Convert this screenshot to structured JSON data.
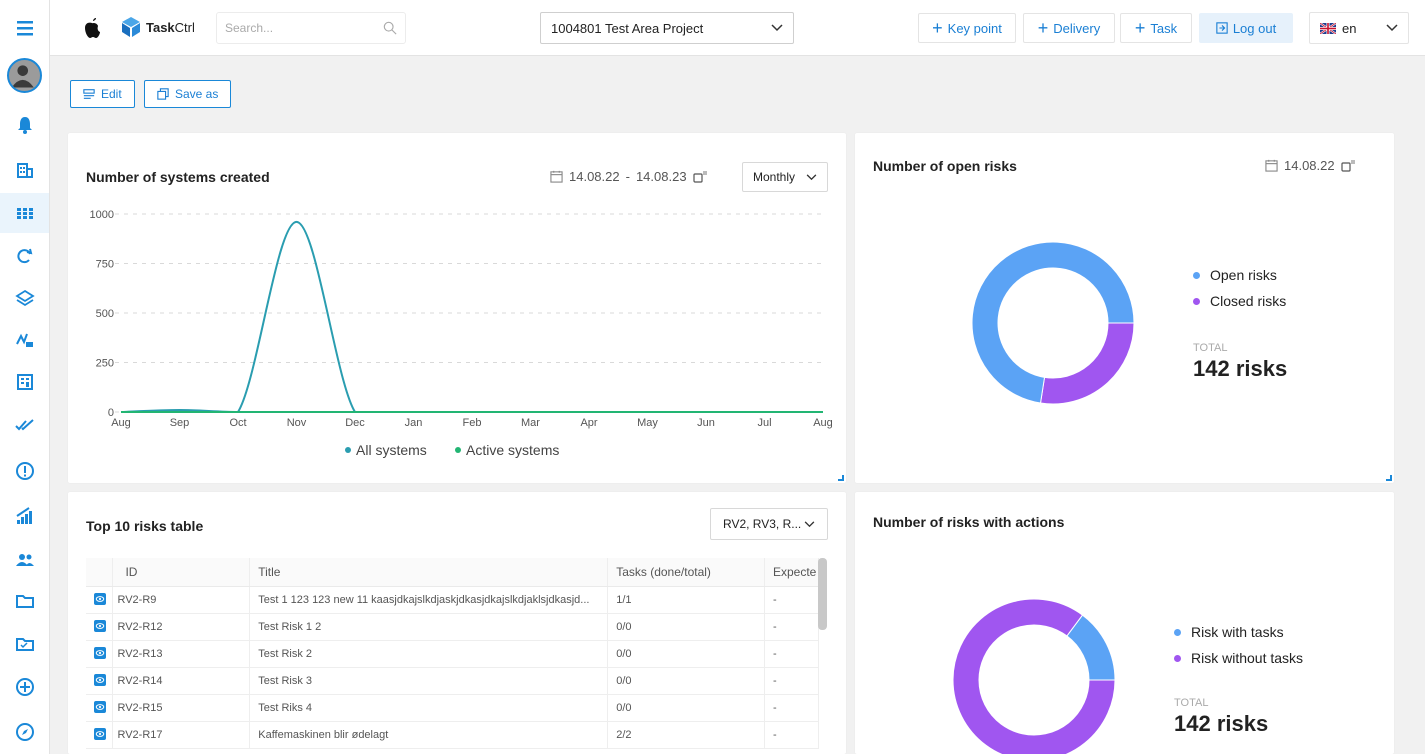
{
  "header": {
    "app_name_bold": "Task",
    "app_name_regular": "Ctrl",
    "search_placeholder": "Search...",
    "project": "1004801 Test Area Project",
    "buttons": {
      "key_point": "Key point",
      "delivery": "Delivery",
      "task": "Task",
      "logout": "Log out"
    },
    "language": "en"
  },
  "actions": {
    "edit": "Edit",
    "save_as": "Save as"
  },
  "systems_card": {
    "title": "Number of systems created",
    "date_from": "14.08.22",
    "date_sep": "-",
    "date_to": "14.08.23",
    "period": "Monthly",
    "chart_data": {
      "type": "line",
      "x": [
        "Aug",
        "Sep",
        "Oct",
        "Nov",
        "Dec",
        "Jan",
        "Feb",
        "Mar",
        "Apr",
        "May",
        "Jun",
        "Jul",
        "Aug"
      ],
      "series": [
        {
          "name": "All systems",
          "values": [
            0,
            10,
            0,
            960,
            0,
            0,
            0,
            0,
            0,
            0,
            0,
            0,
            0
          ],
          "color": "#2a9db0"
        },
        {
          "name": "Active systems",
          "values": [
            0,
            0,
            0,
            0,
            0,
            0,
            0,
            0,
            0,
            0,
            0,
            0,
            0
          ],
          "color": "#22b573"
        }
      ],
      "yticks": [
        "1000",
        "750",
        "500",
        "250",
        "0"
      ],
      "ylim": [
        0,
        1000
      ],
      "grid": true,
      "legend": "bottom"
    }
  },
  "open_risks_card": {
    "title": "Number of open risks",
    "date": "14.08.22",
    "chart_data": {
      "type": "pie",
      "categories": [
        "Open risks",
        "Closed risks"
      ],
      "values": [
        103,
        39
      ],
      "colors": [
        "#5ba3f5",
        "#a056f0"
      ]
    },
    "total_label": "TOTAL",
    "total_value": "142 risks"
  },
  "risks_table_card": {
    "title": "Top 10 risks table",
    "filter": "RV2, RV3, R...",
    "columns": [
      "ID",
      "Title",
      "Tasks (done/total)",
      "Expecte"
    ],
    "rows": [
      [
        "RV2-R9",
        "Test 1 123 123 new 11 kaasjdkajslkdjaskjdkasjdkajslkdjaklsjdkasjd...",
        "1/1",
        "-"
      ],
      [
        "RV2-R12",
        "Test Risk 1 2",
        "0/0",
        "-"
      ],
      [
        "RV2-R13",
        "Test Risk 2",
        "0/0",
        "-"
      ],
      [
        "RV2-R14",
        "Test Risk 3",
        "0/0",
        "-"
      ],
      [
        "RV2-R15",
        "Test Riks 4",
        "0/0",
        "-"
      ],
      [
        "RV2-R17",
        "Kaffemaskinen blir ødelagt",
        "2/2",
        "-"
      ]
    ]
  },
  "risks_actions_card": {
    "title": "Number of risks with actions",
    "chart_data": {
      "type": "pie",
      "categories": [
        "Risk with tasks",
        "Risk without tasks"
      ],
      "values": [
        21,
        121
      ],
      "colors": [
        "#5ba3f5",
        "#a056f0"
      ]
    },
    "total_label": "TOTAL",
    "total_value": "142 risks"
  }
}
